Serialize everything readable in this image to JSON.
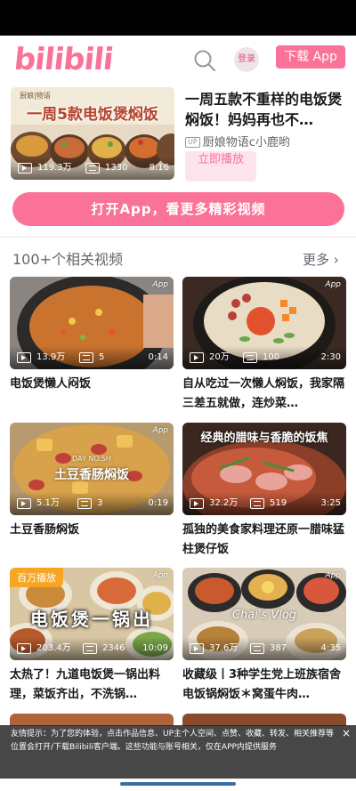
{
  "header": {
    "logo_text": "bilibili",
    "login_label": "登录",
    "download_label": "下载 App"
  },
  "hero": {
    "thumb_caption": "一周5款电饭煲焖饭",
    "thumb_brand": "厨娘|物语",
    "title": "一周五款不重样的电饭煲焖饭！妈妈再也不…",
    "up_badge": "UP",
    "author": "厨娘物语c小鹿哟",
    "plays": "119.3万",
    "danmaku": "1330",
    "duration": "8:16",
    "play_now_label": "立即播放"
  },
  "open_app_label": "打开App，看更多精彩视频",
  "section": {
    "title": "100+个相关视频",
    "more_label": "更多"
  },
  "cards": [
    {
      "title": "电饭煲懒人闷饭",
      "plays": "13.9万",
      "danmaku": "5",
      "duration": "0:14",
      "app_tag": "App"
    },
    {
      "title": "自从吃过一次懒人焖饭，我家隔三差五就做，连炒菜…",
      "plays": "20万",
      "danmaku": "100",
      "duration": "2:30",
      "app_tag": "App"
    },
    {
      "title": "土豆香肠焖饭",
      "plays": "5.1万",
      "danmaku": "3",
      "duration": "0:19",
      "app_tag": "App",
      "overlay_en": "DAY  NO.SH",
      "overlay": "土豆香肠焖饭"
    },
    {
      "title": "孤独的美食家料理还原一腊味猛柱煲仔饭",
      "plays": "32.2万",
      "danmaku": "519",
      "duration": "3:25",
      "app_tag": "App",
      "overlay": "经典的腊味与香脆的饭焦"
    },
    {
      "title": "太热了！九道电饭煲一锅出料理，菜饭齐出，不洗锅…",
      "plays": "203.4万",
      "danmaku": "2346",
      "duration": "10:09",
      "app_tag": "App",
      "corner_label": "百万播放",
      "overlay": "电饭煲一锅出"
    },
    {
      "title": "收藏级丨3种学生党上班族宿舍电饭锅焖饭＊窝蛋牛肉…",
      "plays": "37.6万",
      "danmaku": "387",
      "duration": "4:35",
      "app_tag": "App",
      "overlay": "Chai's Vlog"
    }
  ],
  "toast": {
    "text": "友情提示：为了您的体验，点击作品信息、UP主个人空间、点赞、收藏、转发、相关推荐等位置会打开/下载Bilibili客户端。这些功能与账号相关，仅在APP内提供服务",
    "close": "×"
  },
  "colors": {
    "brand": "#fb7299",
    "text": "#18191c",
    "muted": "#61666d"
  }
}
